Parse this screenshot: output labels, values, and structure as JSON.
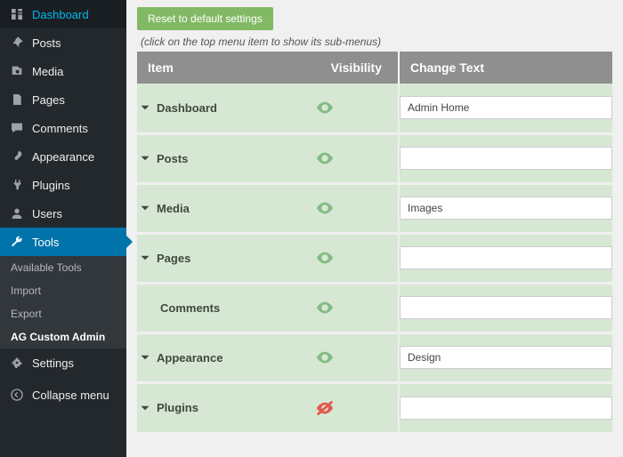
{
  "sidebar": {
    "items": [
      {
        "label": "Dashboard",
        "icon": "dashboard"
      },
      {
        "label": "Posts",
        "icon": "pin"
      },
      {
        "label": "Media",
        "icon": "media"
      },
      {
        "label": "Pages",
        "icon": "page"
      },
      {
        "label": "Comments",
        "icon": "comment"
      },
      {
        "label": "Appearance",
        "icon": "brush"
      },
      {
        "label": "Plugins",
        "icon": "plug"
      },
      {
        "label": "Users",
        "icon": "user"
      },
      {
        "label": "Tools",
        "icon": "wrench",
        "active": true
      },
      {
        "label": "Settings",
        "icon": "settings"
      }
    ],
    "submenu": [
      {
        "label": "Available Tools"
      },
      {
        "label": "Import"
      },
      {
        "label": "Export"
      },
      {
        "label": "AG Custom Admin",
        "current": true
      }
    ],
    "collapse_label": "Collapse menu"
  },
  "controls": {
    "reset_label": "Reset to default settings",
    "hint": "(click on the top menu item to show its sub-menus)"
  },
  "table": {
    "headers": {
      "item": "Item",
      "visibility": "Visibility",
      "change": "Change Text"
    },
    "rows": [
      {
        "label": "Dashboard",
        "caret": true,
        "visible": true,
        "value": "Admin Home"
      },
      {
        "label": "Posts",
        "caret": true,
        "visible": true,
        "value": ""
      },
      {
        "label": "Media",
        "caret": true,
        "visible": true,
        "value": "Images"
      },
      {
        "label": "Pages",
        "caret": true,
        "visible": true,
        "value": ""
      },
      {
        "label": "Comments",
        "caret": false,
        "visible": true,
        "value": ""
      },
      {
        "label": "Appearance",
        "caret": true,
        "visible": true,
        "value": "Design"
      },
      {
        "label": "Plugins",
        "caret": true,
        "visible": false,
        "value": ""
      }
    ]
  }
}
